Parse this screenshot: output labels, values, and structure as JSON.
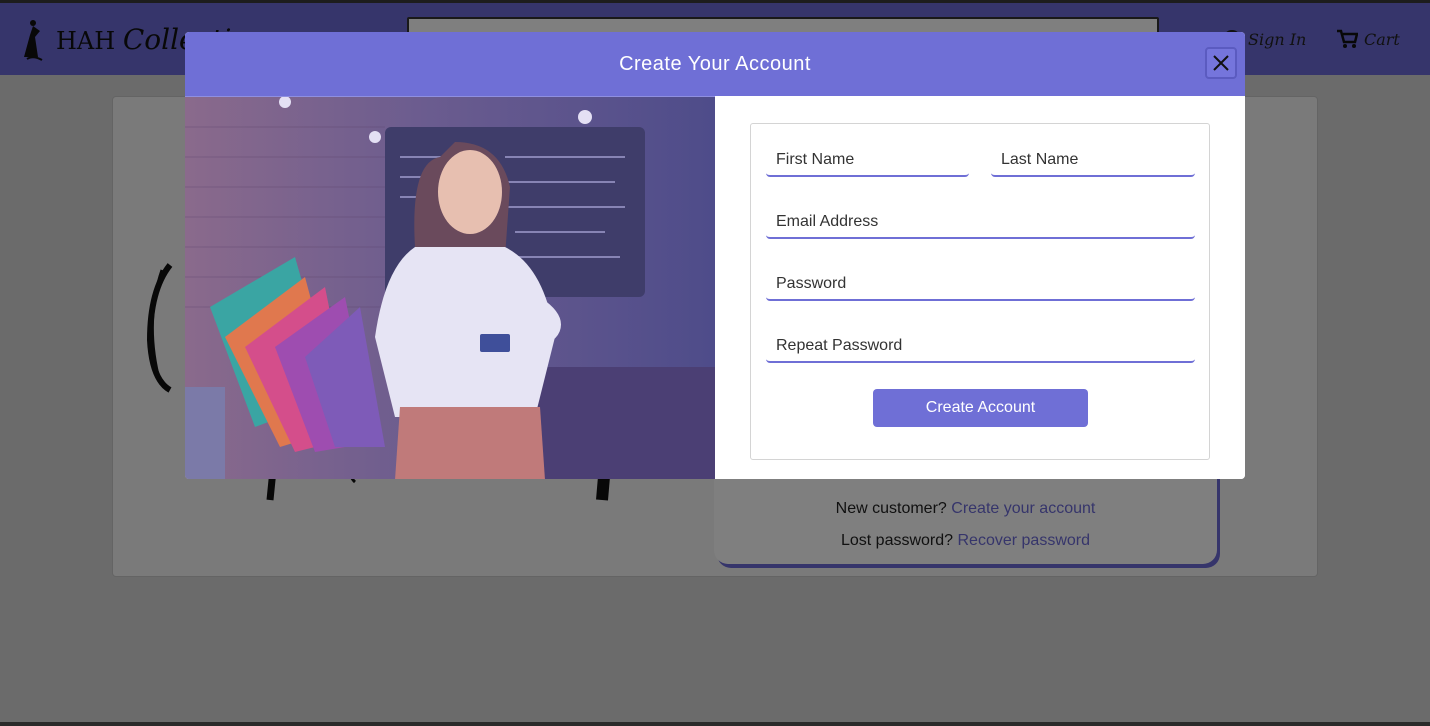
{
  "header": {
    "brand_prefix": "HAH",
    "brand_script": "Collections",
    "sign_in_label": "Sign In",
    "cart_label": "Cart"
  },
  "login_card": {
    "new_customer_text": "New customer?",
    "create_link": "Create your account",
    "lost_password_text": "Lost password?",
    "recover_link": "Recover password"
  },
  "modal": {
    "title": "Create Your Account",
    "image_alt": "Smiling woman holding colorful shopping bags and a credit card",
    "form": {
      "first_name_placeholder": "First Name",
      "last_name_placeholder": "Last Name",
      "email_placeholder": "Email Address",
      "password_placeholder": "Password",
      "repeat_password_placeholder": "Repeat Password",
      "submit_label": "Create Account"
    }
  },
  "colors": {
    "accent": "#6f6fd6",
    "header_bg": "#6d6bd6"
  },
  "icons": {
    "close": "close-icon",
    "user": "user-icon",
    "cart": "cart-icon",
    "logo": "dancer-logo-icon"
  }
}
